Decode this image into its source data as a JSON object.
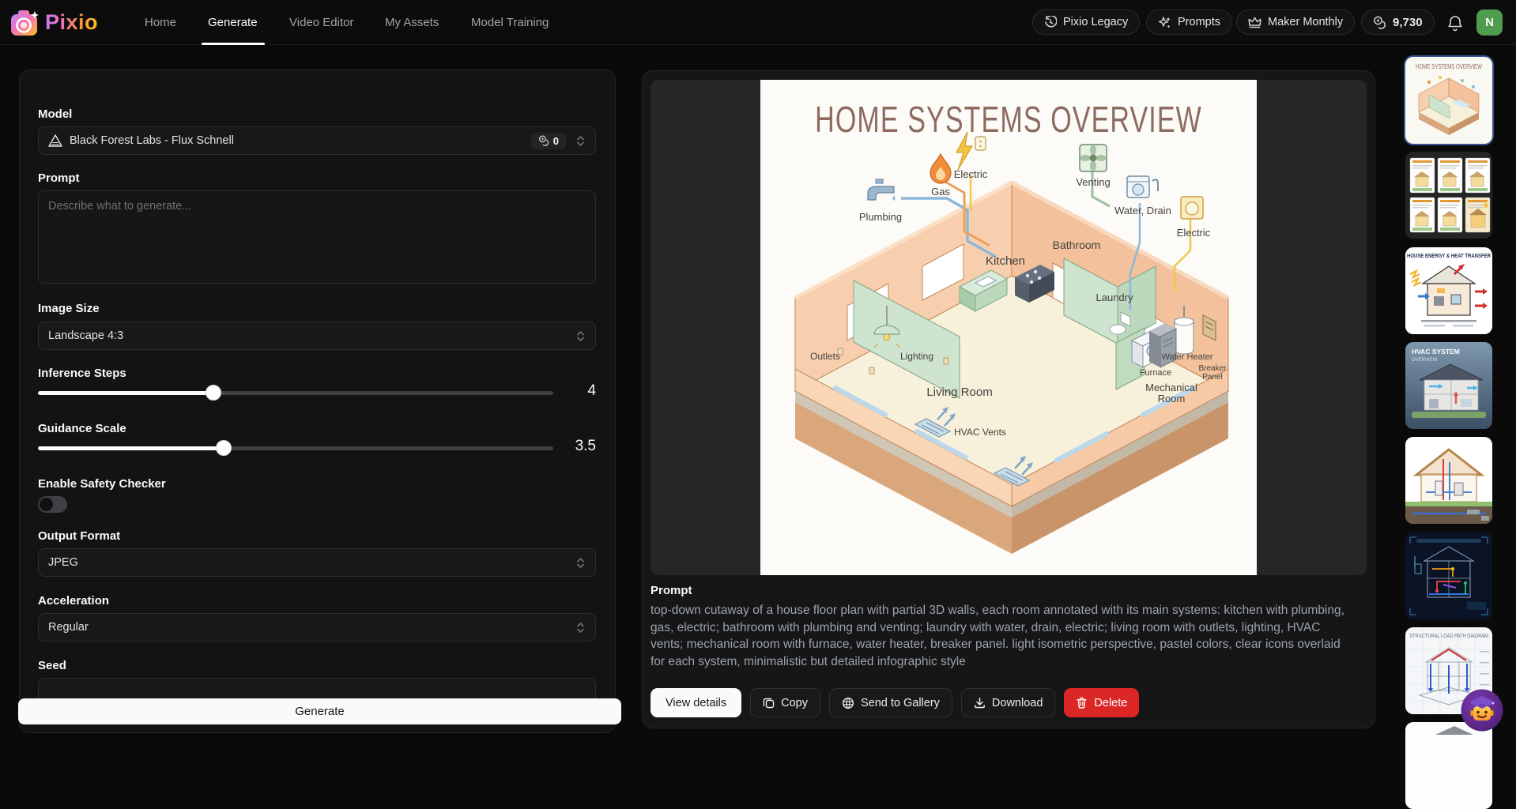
{
  "nav": {
    "brand": "Pixio",
    "links": [
      {
        "label": "Home"
      },
      {
        "label": "Generate"
      },
      {
        "label": "Video Editor"
      },
      {
        "label": "My Assets"
      },
      {
        "label": "Model Training"
      }
    ],
    "active_link": "Generate",
    "pills": [
      {
        "icon": "history-icon",
        "label": "Pixio Legacy"
      },
      {
        "icon": "sparkles-icon",
        "label": "Prompts"
      },
      {
        "icon": "crown-icon",
        "label": "Maker Monthly"
      }
    ],
    "credits": "9,730",
    "avatar_initial": "N"
  },
  "generator": {
    "model": {
      "label": "Model",
      "value": "Black Forest Labs - Flux Schnell",
      "credits": "0"
    },
    "prompt": {
      "label": "Prompt",
      "placeholder": "Describe what to generate...",
      "value": ""
    },
    "image_size": {
      "label": "Image Size",
      "value": "Landscape 4:3"
    },
    "inference_steps": {
      "label": "Inference Steps",
      "value": "4"
    },
    "guidance_scale": {
      "label": "Guidance Scale",
      "value": "3.5"
    },
    "safety_checker": {
      "label": "Enable Safety Checker",
      "enabled": false
    },
    "output_format": {
      "label": "Output Format",
      "value": "JPEG"
    },
    "acceleration": {
      "label": "Acceleration",
      "value": "Regular"
    },
    "seed": {
      "label": "Seed",
      "value": ""
    },
    "generate_label": "Generate"
  },
  "result": {
    "prompt_label": "Prompt",
    "prompt_text": "top-down cutaway of a house floor plan with partial 3D walls, each room annotated with its main systems: kitchen with plumbing, gas, electric; bathroom with plumbing and venting; laundry with water, drain, electric; living room with outlets, lighting, HVAC vents; mechanical room with furnace, water heater, breaker panel. light isometric perspective, pastel colors, clear icons overlaid for each system, minimalistic but detailed infographic style",
    "actions": {
      "view_details": "View details",
      "copy": "Copy",
      "send_to_gallery": "Send to Gallery",
      "download": "Download",
      "delete": "Delete"
    }
  },
  "image": {
    "title": "HOME SYSTEMS OVERVIEW",
    "labels": {
      "plumbing": "Plumbing",
      "gas": "Gas",
      "electric_top": "Electric",
      "venting": "Venting",
      "water_drain": "Water, Drain",
      "electric_right": "Electric",
      "kitchen": "Kitchen",
      "bathroom": "Bathroom",
      "laundry": "Laundry",
      "living_room": "Living Room",
      "outlets": "Outlets",
      "lighting": "Lighting",
      "hvac_vents": "HVAC Vents",
      "furnace": "Furnace",
      "water_heater": "Water Heater",
      "breaker_1": "Breaker",
      "breaker_2": "Panel",
      "mechanical_1": "Mechanical",
      "mechanical_2": "Room"
    }
  },
  "thumbnails": [
    {
      "title": "HOME SYSTEMS OVERVIEW",
      "selected": true
    },
    {
      "title": "",
      "selected": false
    },
    {
      "title": "HOUSE ENERGY & HEAT TRANSFER",
      "selected": false
    },
    {
      "title": "HVAC SYSTEM",
      "subtitle": "OVERVIEW",
      "selected": false
    },
    {
      "title": "",
      "selected": false
    },
    {
      "title": "",
      "selected": false
    },
    {
      "title": "STRUCTURAL LOAD PATH DIAGRAM",
      "selected": false
    },
    {
      "title": "",
      "selected": false
    }
  ]
}
